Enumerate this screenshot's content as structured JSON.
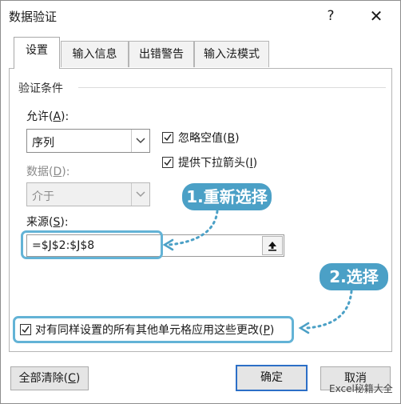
{
  "dialog": {
    "title": "数据验证",
    "help": "?",
    "close": "✕"
  },
  "tabs": [
    "设置",
    "输入信息",
    "出错警告",
    "输入法模式"
  ],
  "section": {
    "title": "验证条件"
  },
  "allow": {
    "label": "允许(",
    "key": "A",
    "suffix": "):",
    "value": "序列"
  },
  "data": {
    "label": "数据(",
    "key": "D",
    "suffix": "):",
    "value": "介于"
  },
  "checkboxes": {
    "ignore_blank": {
      "label": "忽略空值(",
      "key": "B",
      "suffix": ")",
      "checked": true
    },
    "dropdown": {
      "label": "提供下拉箭头(",
      "key": "I",
      "suffix": ")",
      "checked": true
    },
    "apply_all": {
      "label": "对有同样设置的所有其他单元格应用这些更改(",
      "key": "P",
      "suffix": ")",
      "checked": true
    }
  },
  "source": {
    "label": "来源(",
    "key": "S",
    "suffix": "):",
    "value": "=$J$2:$J$8"
  },
  "callouts": {
    "first": "1.重新选择",
    "second": "2.选择"
  },
  "buttons": {
    "clear": "全部清除(",
    "clear_key": "C",
    "clear_suffix": ")",
    "ok": "确定",
    "cancel": "取消"
  },
  "watermark": "Excel秘籍大全",
  "colors": {
    "callout": "#4ba0c6",
    "highlight": "#63b3d6",
    "default_border": "#2c6fc7"
  }
}
